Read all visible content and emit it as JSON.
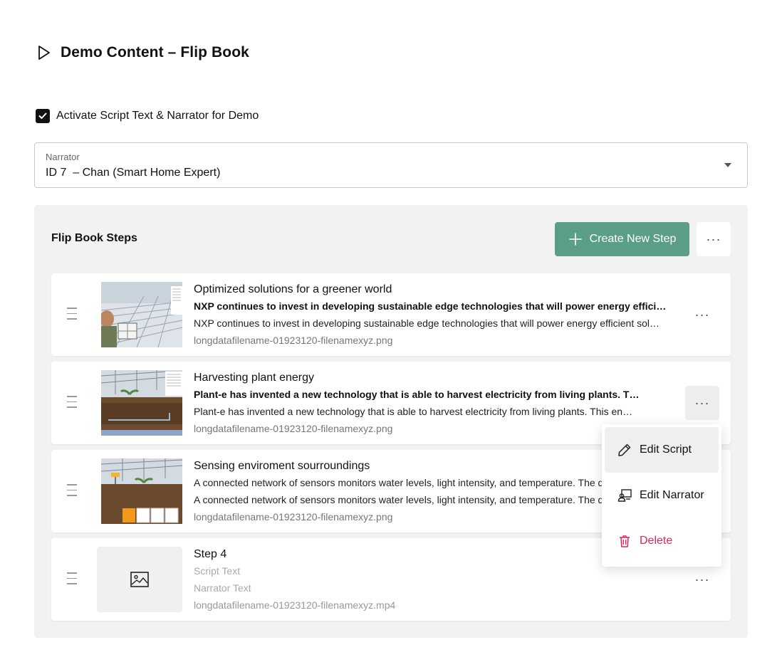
{
  "header": {
    "title": "Demo Content – Flip Book",
    "icon": "play-outline-icon"
  },
  "activate": {
    "label": "Activate Script Text & Narrator for Demo",
    "checked": true
  },
  "narrator": {
    "label": "Narrator",
    "value": "ID 7  – Chan (Smart Home Expert)"
  },
  "steps_panel": {
    "title": "Flip Book Steps",
    "create_button": "Create New Step",
    "more_label": "···",
    "accent_color": "#5a9e87"
  },
  "steps": [
    {
      "title": "Optimized solutions for a greener world",
      "script": "NXP continues to invest in developing sustainable edge technologies that will power energy efficient solutions for a greener world",
      "narrator": "NXP continues to invest in developing sustainable edge technologies that will power energy efficient solutions for a greener world",
      "file": "longdatafilename-01923120-filenamexyz.png",
      "more": "···"
    },
    {
      "title": "Harvesting plant energy",
      "script": "Plant-e has invented a new technology that is able to harvest electricity from living plants. This energy can power sensors",
      "narrator": "Plant-e has invented a new technology that is able to harvest electricity from living plants. This energy can power sensors",
      "file": "longdatafilename-01923120-filenamexyz.png",
      "more": "···"
    },
    {
      "title": "Sensing enviroment sourroundings",
      "script": "A connected network of sensors monitors water levels, light intensity, and temperature. The data is sent to the cloud",
      "narrator": "A connected network of sensors monitors water levels, light intensity, and temperature. The data is sent to the cloud",
      "file": "longdatafilename-01923120-filenamexyz.png",
      "more": "···"
    },
    {
      "title": "Step 4",
      "script": "Script Text",
      "narrator": "Narrator Text",
      "file": "longdatafilename-01923120-filenamexyz.mp4",
      "more": "···"
    }
  ],
  "context_menu": {
    "items": [
      {
        "label": "Edit Script",
        "icon": "pencil-icon"
      },
      {
        "label": "Edit Narrator",
        "icon": "narrator-icon"
      },
      {
        "label": "Delete",
        "icon": "trash-icon",
        "color": "#e0245e"
      }
    ]
  }
}
